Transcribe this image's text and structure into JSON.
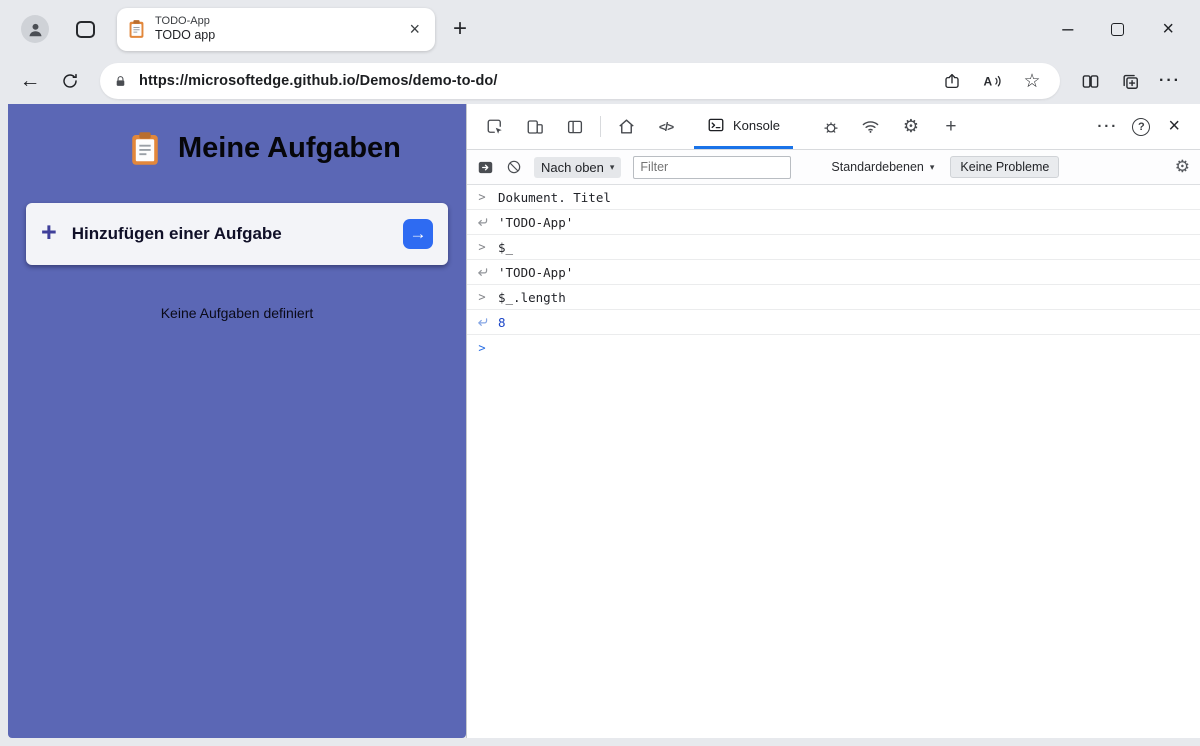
{
  "browser": {
    "tab_tooltip": "TODO-App",
    "tab_title": "TODO app",
    "url": "https://microsoftedge.github.io/Demos/demo-to-do/"
  },
  "app": {
    "title": "Meine Aufgaben",
    "add_task_label": "Hinzufügen einer Aufgabe",
    "empty_message": "Keine Aufgaben definiert"
  },
  "devtools": {
    "console_tab_label": "Konsole",
    "toolbar": {
      "context_selector": "Nach oben",
      "filter_placeholder": "Filter",
      "log_levels": "Standardebenen",
      "issues_label": "Keine Probleme"
    },
    "console_rows": [
      {
        "kind": "command",
        "text": "Dokument. Titel"
      },
      {
        "kind": "result",
        "text": "'TODO-App'"
      },
      {
        "kind": "command",
        "text": "$_"
      },
      {
        "kind": "result",
        "text": "'TODO-App'"
      },
      {
        "kind": "command",
        "text": "$_.length"
      },
      {
        "kind": "result_number",
        "text": "8"
      },
      {
        "kind": "prompt",
        "text": ""
      }
    ]
  },
  "icons": {
    "back": "←",
    "new_tab": "+",
    "close": "×",
    "minimize": "–",
    "star": "☆",
    "more_dots": "···",
    "sources": "</>",
    "add_tools": "+",
    "help": "?",
    "caret": "▾",
    "gear": "⚙",
    "plus": "+",
    "arrow_right": "→",
    "chevron": ">"
  },
  "colors": {
    "accent_blue": "#1a73e8",
    "panel_purple": "#5b67b5",
    "go_button_blue": "#2e6bf2",
    "result_number_blue": "#1c46c7"
  }
}
